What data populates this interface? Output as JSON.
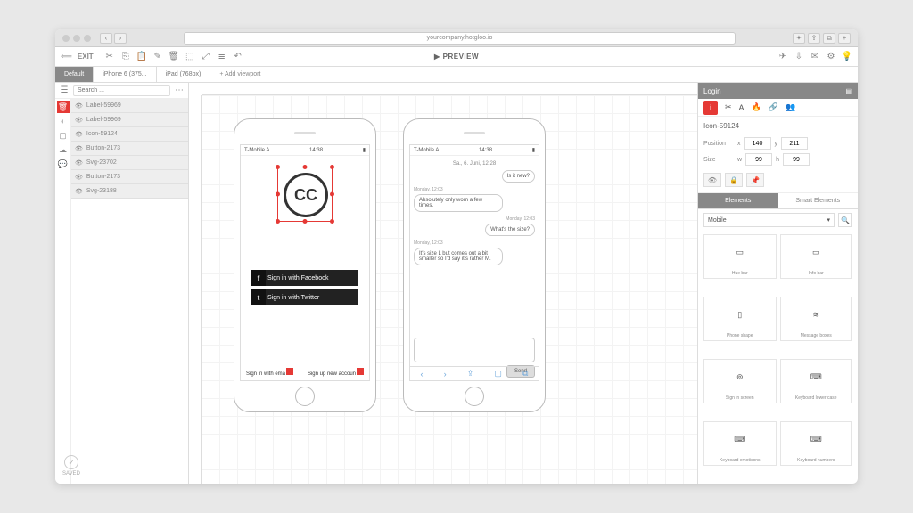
{
  "browser": {
    "url": "yourcompany.hotgloo.io"
  },
  "toolbar": {
    "exit": "EXIT",
    "preview": "PREVIEW"
  },
  "tabs": [
    "Default",
    "iPhone 6 (375...",
    "iPad (768px)"
  ],
  "addViewport": "+ Add viewport",
  "layers": {
    "searchPlaceholder": "Search ...",
    "items": [
      {
        "label": "Label-59969"
      },
      {
        "label": "Label-59969"
      },
      {
        "label": "Icon-59124"
      },
      {
        "label": "Button-2173"
      },
      {
        "label": "Svg-23702"
      },
      {
        "label": "Button-2173"
      },
      {
        "label": "Svg-23188"
      }
    ]
  },
  "phone1": {
    "carrier": "T-Mobile A",
    "time": "14:38",
    "cc": "CC",
    "fb": "Sign in with Facebook",
    "tw": "Sign in with Twitter",
    "email": "Sign in with ema",
    "signup": "Sign up new accoun"
  },
  "phone2": {
    "carrier": "T-Mobile A",
    "time": "14:38",
    "date": "Sa., 6. Juni, 12:28",
    "msgs": [
      {
        "side": "right",
        "text": "Is it new?"
      },
      {
        "side": "left",
        "stamp": "Monday, 12:03",
        "text": "Absolutely only worn a few times."
      },
      {
        "side": "right",
        "stamp": "Monday, 12:03",
        "text": "What's the size?"
      },
      {
        "side": "left",
        "stamp": "Monday, 12:03",
        "text": "It's size L but comes out a bit smaller so I'd say it's rather M."
      }
    ],
    "send": "Send"
  },
  "inspector": {
    "header": "Login",
    "selected": "Icon-59124",
    "position_label": "Position",
    "size_label": "Size",
    "x": "140",
    "y": "211",
    "w": "99",
    "h": "99",
    "x_label": "x",
    "y_label": "y",
    "w_label": "w",
    "h_label": "h"
  },
  "elements": {
    "tab1": "Elements",
    "tab2": "Smart Elements",
    "category": "Mobile",
    "items": [
      "Hue bar",
      "Info bar",
      "Phone shape",
      "Message boxes",
      "Sign in screen",
      "Keyboard lower case",
      "Keyboard emoticons",
      "Keyboard numbers"
    ]
  },
  "saved": "SAVED"
}
